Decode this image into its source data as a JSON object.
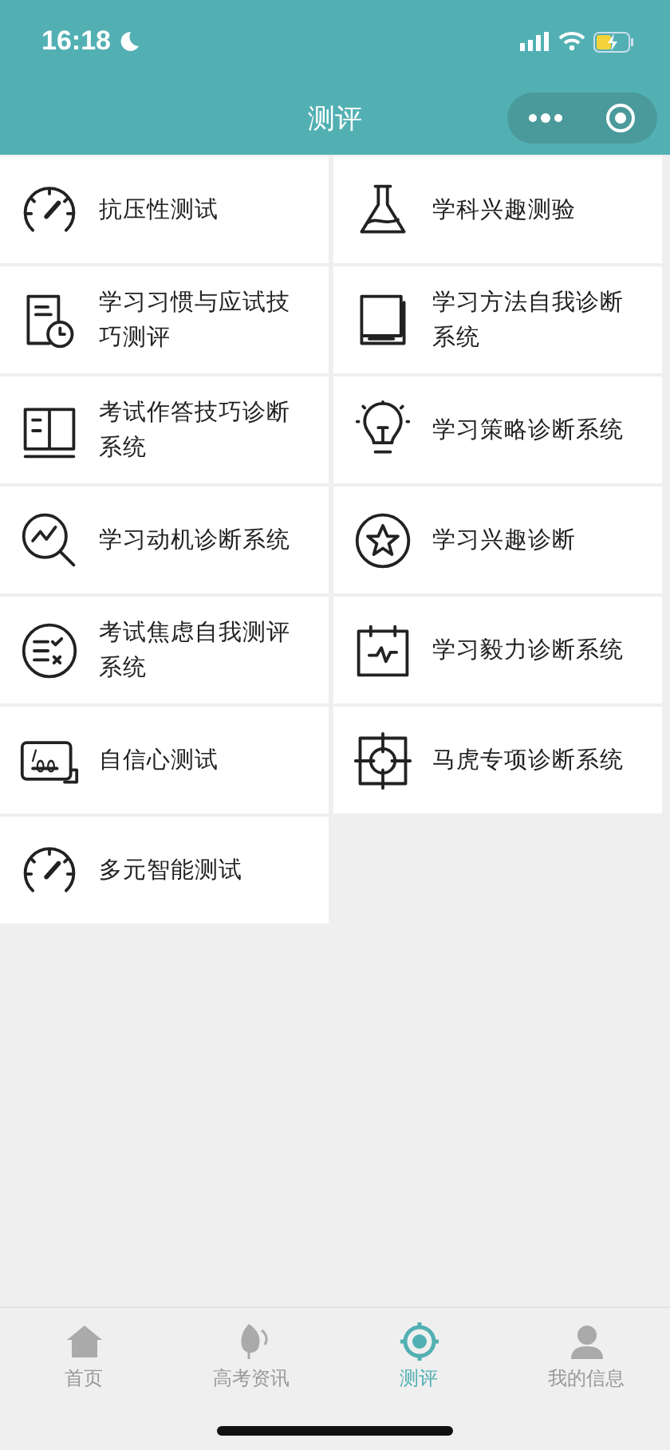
{
  "status_bar": {
    "time": "16:18"
  },
  "header": {
    "title": "测评"
  },
  "items": [
    {
      "kind": "gauge",
      "label": "抗压性测试"
    },
    {
      "kind": "flask",
      "label": "学科兴趣测验"
    },
    {
      "kind": "doc-clock",
      "label": "学习习惯与应试技巧测评"
    },
    {
      "kind": "book",
      "label": "学习方法自我诊断系统"
    },
    {
      "kind": "open-book",
      "label": "考试作答技巧诊断系统"
    },
    {
      "kind": "bulb",
      "label": "学习策略诊断系统"
    },
    {
      "kind": "chart-search",
      "label": "学习动机诊断系统"
    },
    {
      "kind": "star",
      "label": "学习兴趣诊断"
    },
    {
      "kind": "checklist",
      "label": "考试焦虑自我测评系统"
    },
    {
      "kind": "calendar",
      "label": "学习毅力诊断系统"
    },
    {
      "kind": "score",
      "label": "自信心测试"
    },
    {
      "kind": "target",
      "label": "马虎专项诊断系统"
    },
    {
      "kind": "gauge",
      "label": "多元智能测试"
    }
  ],
  "tab_bar": [
    {
      "kind": "home",
      "label": "首页",
      "selected": false
    },
    {
      "kind": "leaf",
      "label": "高考资讯",
      "selected": false
    },
    {
      "kind": "target",
      "label": "测评",
      "selected": true
    },
    {
      "kind": "user",
      "label": "我的信息",
      "selected": false
    }
  ]
}
